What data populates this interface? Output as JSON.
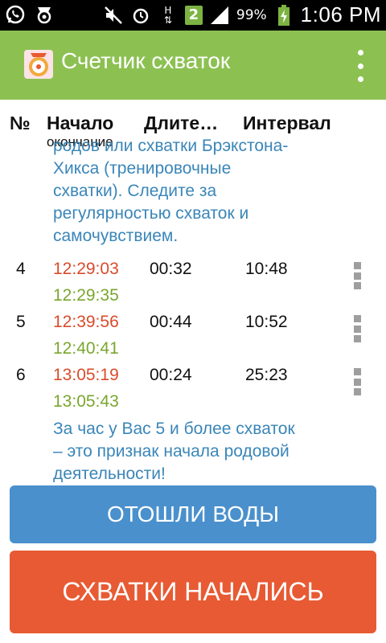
{
  "status_bar": {
    "battery": "99%",
    "time": "1:06 PM",
    "sim_badge": "2",
    "network_label": "H"
  },
  "app_bar": {
    "title": "Счетчик схваток"
  },
  "columns": {
    "number": "№",
    "start": "Начало",
    "start_sub": "окончание",
    "duration": "Длите…",
    "interval": "Интервал"
  },
  "top_message": [
    "родов или схватки Брэкстона-",
    "Хикса (тренировочные",
    "схватки). Следите за",
    "регулярностью схваток и",
    "самочувствием."
  ],
  "rows": [
    {
      "num": "4",
      "start": "12:29:03",
      "end": "12:29:35",
      "duration": "00:32",
      "interval": "10:48"
    },
    {
      "num": "5",
      "start": "12:39:56",
      "end": "12:40:41",
      "duration": "00:44",
      "interval": "10:52"
    },
    {
      "num": "6",
      "start": "13:05:19",
      "end": "13:05:43",
      "duration": "00:24",
      "interval": "25:23"
    }
  ],
  "bottom_message": [
    "За час у Вас 5 и более схваток",
    "– это признак начала родовой",
    "деятельности!"
  ],
  "buttons": {
    "water_broke": "ОТОШЛИ ВОДЫ",
    "contractions_started": "СХВАТКИ НАЧАЛИСЬ"
  },
  "colors": {
    "app_bar": "#8cc152",
    "water_button": "#4a90cc",
    "start_button": "#e85a33",
    "start_time": "#d94b2b",
    "end_time": "#7aa62e",
    "message": "#3a86b8"
  }
}
